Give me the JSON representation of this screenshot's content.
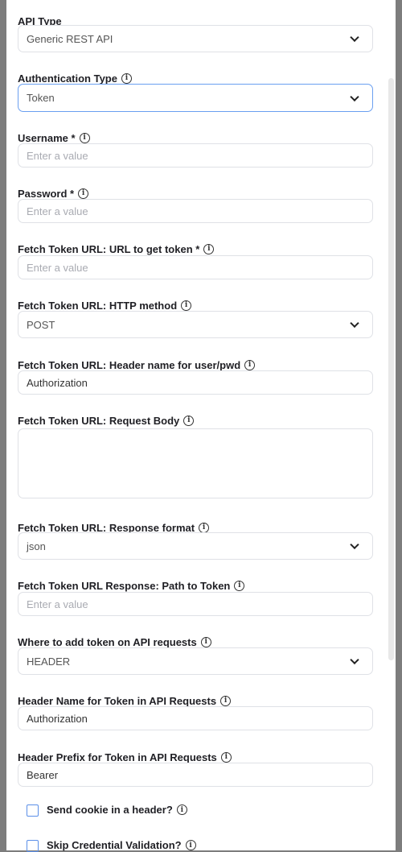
{
  "fields": [
    {
      "label": "API Type",
      "type": "select",
      "value": "Generic REST API",
      "info": false
    },
    {
      "label": "Authentication Type",
      "type": "select",
      "value": "Token",
      "info": true,
      "focused": true
    },
    {
      "label": "Username *",
      "type": "input",
      "placeholder": "Enter a value",
      "info": true
    },
    {
      "label": "Password *",
      "type": "input",
      "placeholder": "Enter a value",
      "info": true
    },
    {
      "label": "Fetch Token URL: URL to get token *",
      "type": "input",
      "placeholder": "Enter a value",
      "info": true
    },
    {
      "label": "Fetch Token URL: HTTP method",
      "type": "select",
      "value": "POST",
      "info": true
    },
    {
      "label": "Fetch Token URL: Header name for user/pwd",
      "type": "input",
      "value": "Authorization",
      "info": true
    },
    {
      "label": "Fetch Token URL: Request Body",
      "type": "textarea",
      "value": "",
      "info": true
    },
    {
      "label": "Fetch Token URL: Response format",
      "type": "select",
      "value": "json",
      "info": true
    },
    {
      "label": "Fetch Token URL Response: Path to Token",
      "type": "input",
      "placeholder": "Enter a value",
      "info": true
    },
    {
      "label": "Where to add token on API requests",
      "type": "select",
      "value": "HEADER",
      "info": true
    },
    {
      "label": "Header Name for Token in API Requests",
      "type": "input",
      "value": "Authorization",
      "info": true
    },
    {
      "label": "Header Prefix for Token in API Requests",
      "type": "input",
      "value": "Bearer",
      "info": true
    }
  ],
  "checkboxes": [
    {
      "label": "Send cookie in a header?",
      "checked": false
    },
    {
      "label": "Skip Credential Validation?",
      "checked": false
    }
  ],
  "info_glyph": "i",
  "colors": {
    "focus": "#6a9ff0",
    "checkbox": "#5b8fe8"
  }
}
